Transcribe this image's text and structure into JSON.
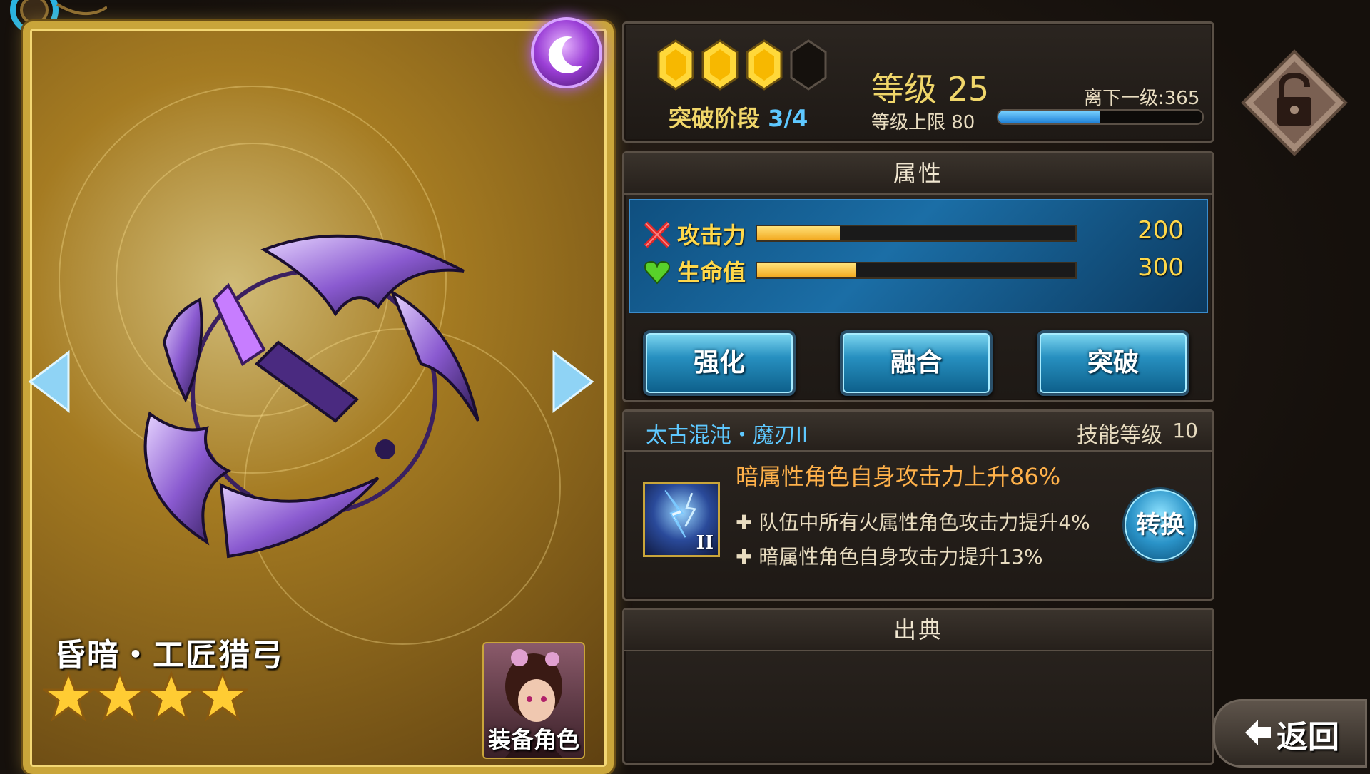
{
  "card": {
    "name": "昏暗・工匠猎弓",
    "stars": 4,
    "equip_label": "装备角色"
  },
  "breakthrough": {
    "label": "突破阶段",
    "value": "3/4",
    "gems_filled": 3,
    "gems_total": 4
  },
  "level": {
    "label": "等级 25",
    "cap": "等级上限 80",
    "next": "离下一级:365",
    "exp_fraction": 0.5
  },
  "attributes": {
    "title": "属性",
    "stats": [
      {
        "name": "攻击力",
        "value": "200",
        "fill": 0.26
      },
      {
        "name": "生命值",
        "value": "300",
        "fill": 0.31
      }
    ]
  },
  "actions": [
    "强化",
    "融合",
    "突破"
  ],
  "skill": {
    "name": "太古混沌・魔刃II",
    "level_label": "技能等级",
    "level": "10",
    "main_effect": "暗属性角色自身攻击力上升86%",
    "sub_effects": [
      "✚ 队伍中所有火属性角色攻击力提升4%",
      "✚ 暗属性角色自身攻击力提升13%"
    ],
    "icon_badge": "II",
    "convert_label": "转换"
  },
  "origin": {
    "title": "出典"
  },
  "back_label": "返回",
  "colors": {
    "accent_gold": "#f0d66a",
    "accent_blue": "#5ec8ff",
    "skill_effect": "#ffb14a"
  }
}
